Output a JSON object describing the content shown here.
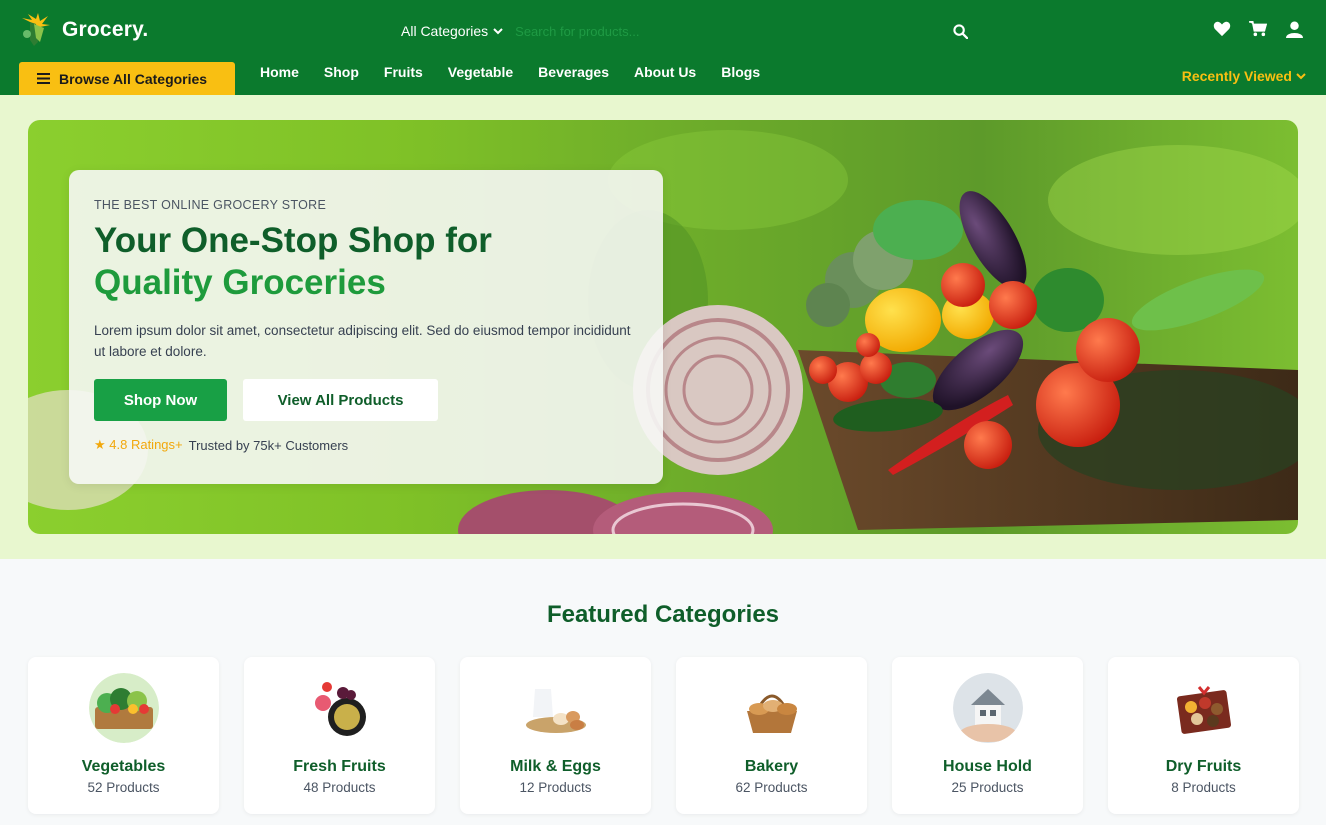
{
  "brand": {
    "name": "Grocery."
  },
  "search": {
    "category": "All Categories",
    "placeholder": "Search for products..."
  },
  "header_icons": [
    "heart-icon",
    "cart-icon",
    "user-icon"
  ],
  "browse": {
    "label": "Browse All Categories"
  },
  "nav": {
    "items": [
      "Home",
      "Shop",
      "Fruits",
      "Vegetable",
      "Beverages",
      "About Us",
      "Blogs"
    ]
  },
  "recently_viewed": "Recently Viewed",
  "hero": {
    "eyebrow": "THE BEST ONLINE GROCERY STORE",
    "title_line1": "Your One-Stop Shop for",
    "title_line2": "Quality Groceries",
    "description": "Lorem ipsum dolor sit amet, consectetur adipiscing elit. Sed do eiusmod tempor incididunt ut labore et dolore.",
    "primary_button": "Shop Now",
    "secondary_button": "View All Products",
    "rating": "★ 4.8 Ratings+",
    "trusted": "Trusted by 75k+ Customers"
  },
  "featured": {
    "title": "Featured Categories",
    "categories": [
      {
        "name": "Vegetables",
        "count": "52 Products"
      },
      {
        "name": "Fresh Fruits",
        "count": "48 Products"
      },
      {
        "name": "Milk & Eggs",
        "count": "12 Products"
      },
      {
        "name": "Bakery",
        "count": "62 Products"
      },
      {
        "name": "House Hold",
        "count": "25 Products"
      },
      {
        "name": "Dry Fruits",
        "count": "8 Products"
      }
    ]
  },
  "colors": {
    "header": "#0b7a2d",
    "accent": "#f9bf12",
    "primary": "#18a045",
    "heading": "#0f5e2a"
  }
}
